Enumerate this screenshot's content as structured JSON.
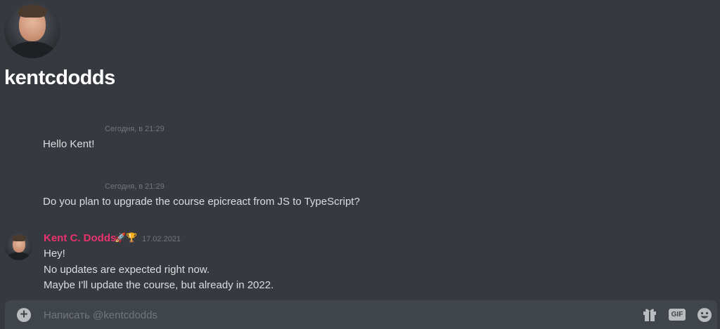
{
  "profile": {
    "username": "kentcdodds"
  },
  "messages": [
    {
      "time": "Сегодня, в 21:29",
      "text": "Hello Kent!"
    },
    {
      "time": "Сегодня, в 21:29",
      "text": "Do you plan to upgrade the course epicreact from JS to TypeScript?"
    }
  ],
  "reply": {
    "author": "Kent C. Dodds",
    "badges": "🚀🏆",
    "time": "17.02.2021",
    "lines": [
      "Hey!",
      "No updates are expected right now.",
      "Maybe I'll update the course, but already in 2022."
    ]
  },
  "composer": {
    "placeholder": "Написать @kentcdodds",
    "plus_icon": "add-circle-icon",
    "gift_icon": "gift-icon",
    "gif_label": "GIF",
    "emoji_icon": "emoji-icon"
  },
  "colors": {
    "background": "#36393f",
    "composer": "#40444b",
    "author": "#e8336d",
    "timestamp": "#72767d"
  }
}
